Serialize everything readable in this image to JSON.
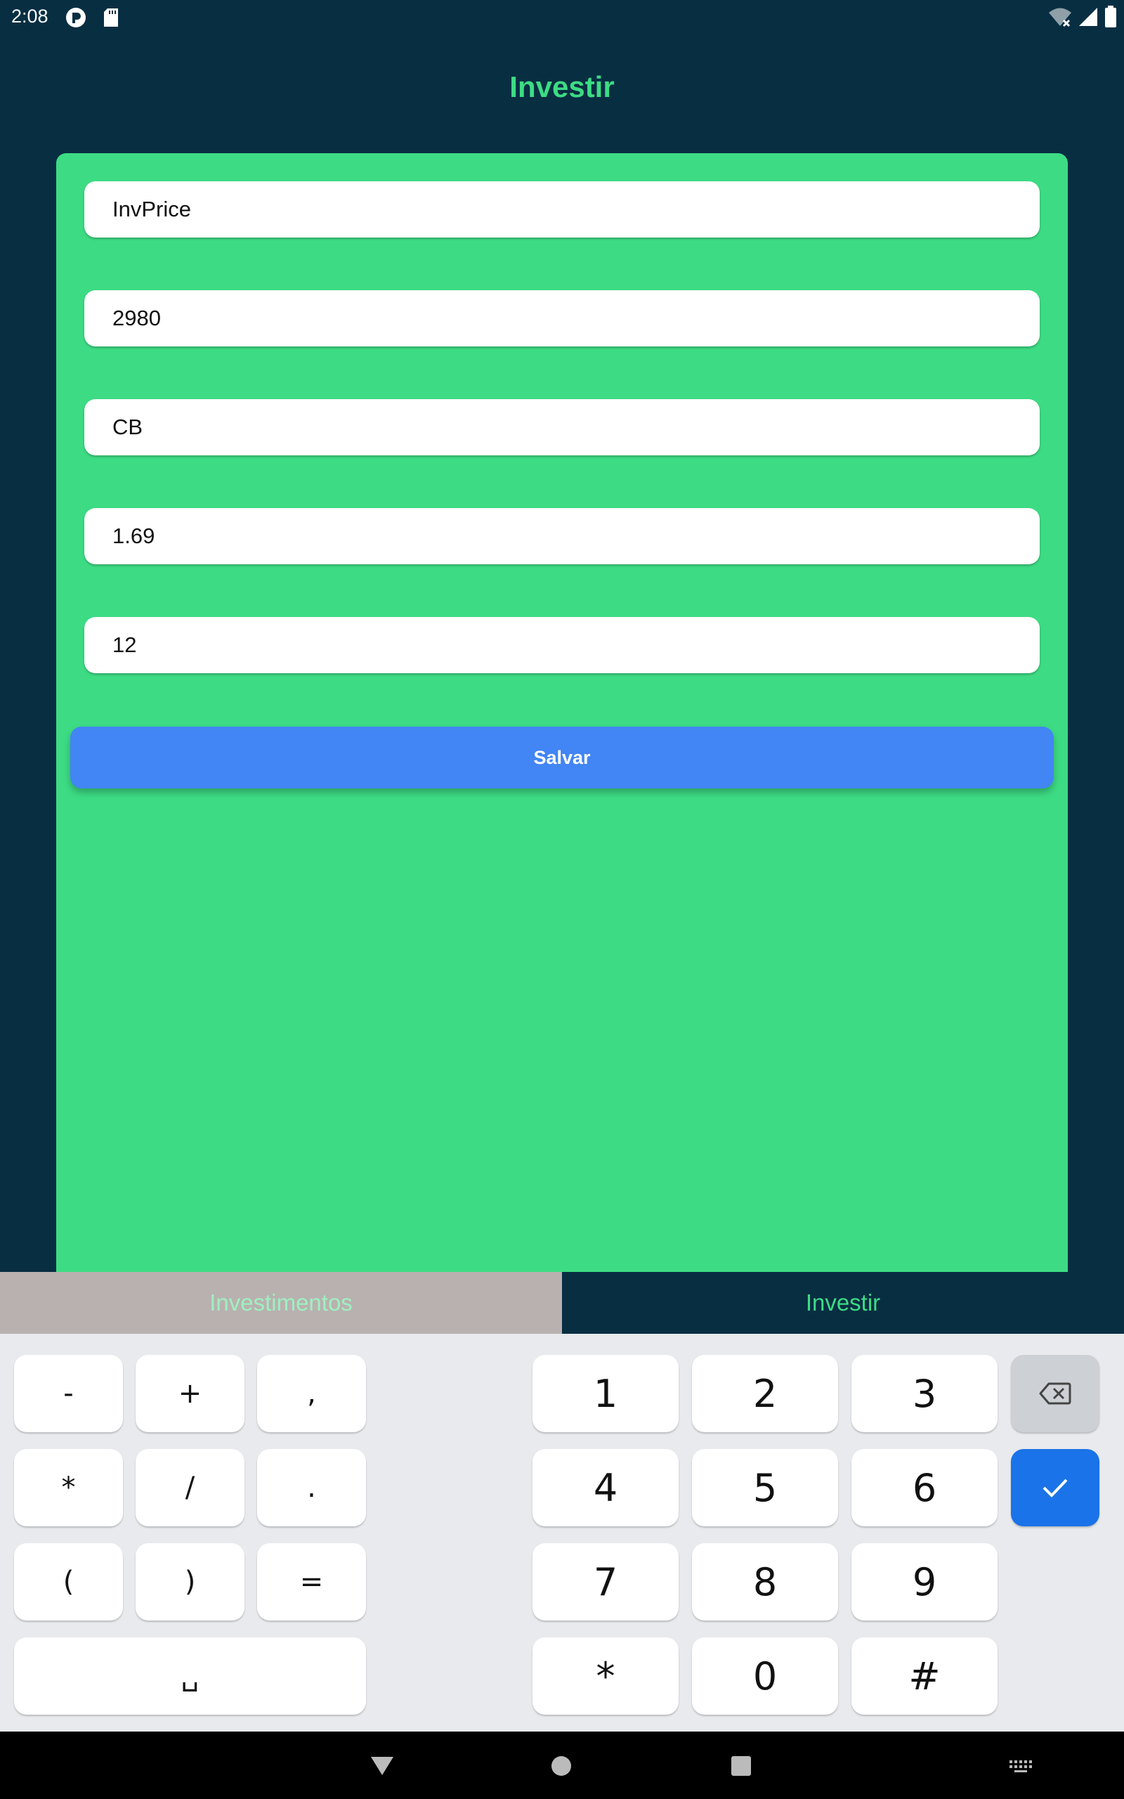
{
  "status_bar": {
    "time": "2:08",
    "left_icons": [
      "app-notification-icon",
      "sd-card-icon"
    ],
    "right_icons": [
      "wifi-icon",
      "cell-signal-icon",
      "battery-icon"
    ]
  },
  "page": {
    "title": "Investir"
  },
  "form": {
    "fields": [
      {
        "value": "InvPrice"
      },
      {
        "value": "2980"
      },
      {
        "value": "CB"
      },
      {
        "value": "1.69"
      },
      {
        "value": "12"
      }
    ],
    "save_label": "Salvar"
  },
  "tabs": [
    {
      "label": "Investimentos",
      "active": false
    },
    {
      "label": "Investir",
      "active": true
    }
  ],
  "keyboard": {
    "symbol_keys": [
      "-",
      "+",
      ",",
      "*",
      "/",
      ".",
      "(",
      ")",
      "="
    ],
    "space_glyph": "␣",
    "number_keys": [
      "1",
      "2",
      "3",
      "4",
      "5",
      "6",
      "7",
      "8",
      "9",
      "*",
      "0",
      "#"
    ],
    "backspace_icon": "backspace-icon",
    "done_icon": "check-icon"
  },
  "colors": {
    "background": "#082e42",
    "accent_green": "#3ddc84",
    "button_blue": "#4285f4",
    "keyboard_done": "#1a73e8",
    "inactive_tab": "#b9b1b0"
  }
}
